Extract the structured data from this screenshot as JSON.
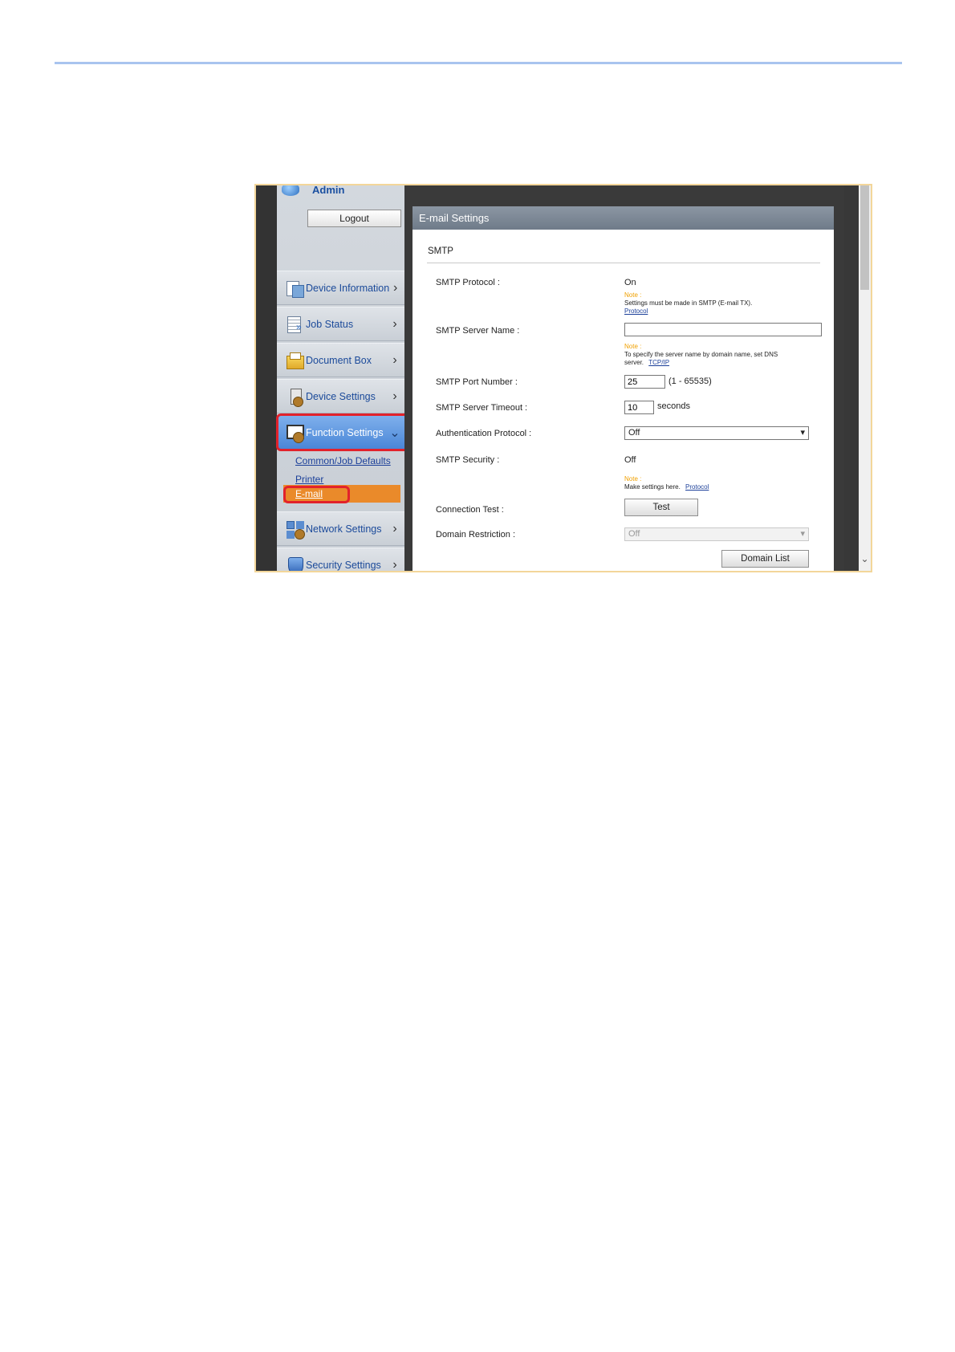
{
  "sidebar": {
    "admin_label": "Admin",
    "logout_label": "Logout",
    "items": [
      {
        "label": "Device Information",
        "icon": "device-information-icon"
      },
      {
        "label": "Job Status",
        "icon": "job-status-icon"
      },
      {
        "label": "Document Box",
        "icon": "document-box-icon"
      },
      {
        "label": "Device Settings",
        "icon": "device-settings-icon"
      },
      {
        "label": "Function Settings",
        "icon": "function-settings-icon"
      },
      {
        "label": "Network Settings",
        "icon": "network-settings-icon"
      },
      {
        "label": "Security Settings",
        "icon": "security-settings-icon"
      }
    ],
    "subitems": [
      "Common/Job Defaults",
      "Printer",
      "E-mail"
    ]
  },
  "main": {
    "header_title": "E-mail Settings",
    "section_title": "SMTP",
    "fields": {
      "smtp_protocol": {
        "label": "SMTP Protocol :",
        "value": "On"
      },
      "smtp_server_name": {
        "label": "SMTP Server Name :",
        "value": ""
      },
      "smtp_port_number": {
        "label": "SMTP Port Number :",
        "value": "25",
        "range": "(1 - 65535)"
      },
      "smtp_server_timeout": {
        "label": "SMTP Server Timeout :",
        "value": "10",
        "unit": "seconds"
      },
      "authentication_protocol": {
        "label": "Authentication Protocol :",
        "value": "Off"
      },
      "smtp_security": {
        "label": "SMTP Security :",
        "value": "Off"
      },
      "connection_test": {
        "label": "Connection Test :",
        "button": "Test"
      },
      "domain_restriction": {
        "label": "Domain Restriction :",
        "value": "Off"
      }
    },
    "notes": {
      "note_label": "Note :",
      "protocol_note": "Settings must be made in SMTP (E-mail TX).",
      "protocol_link": "Protocol",
      "server_note": "To specify the server name by domain name, set DNS",
      "server_note_2": "server.",
      "server_link": "TCP/IP",
      "security_note": "Make settings here.",
      "security_link": "Protocol"
    },
    "domain_list_button": "Domain List"
  },
  "colors": {
    "active_nav": "#4a86d7",
    "selected_subitem": "#ea8a2a",
    "highlight": "#e2222b",
    "frame_border": "#f3d69a",
    "page_rule": "#a9c4ef"
  }
}
